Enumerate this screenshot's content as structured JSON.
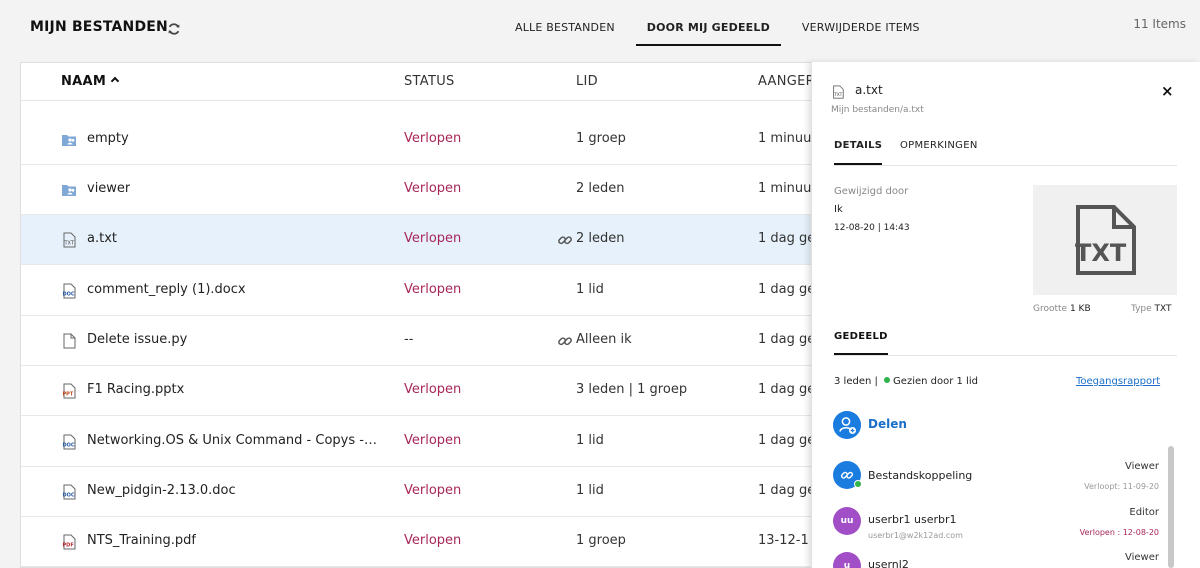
{
  "header": {
    "title": "MIJN BESTANDEN",
    "tabs": [
      "ALLE BESTANDEN",
      "DOOR MIJ GEDEELD",
      "VERWIJDERDE ITEMS"
    ],
    "active_tab": "DOOR MIJ GEDEELD",
    "items_count": "11 Items"
  },
  "table": {
    "columns": [
      "NAAM",
      "STATUS",
      "LID",
      "AANGER"
    ],
    "rows": [
      {
        "name": "empty",
        "icon": "shared-folder-icon",
        "status": "Verlopen",
        "lid": "1 groep",
        "date": "1 minuut",
        "link": false
      },
      {
        "name": "viewer",
        "icon": "shared-folder-icon",
        "status": "Verlopen",
        "lid": "2 leden",
        "date": "1 minuut",
        "link": false
      },
      {
        "name": "a.txt",
        "icon": "txt-file-icon",
        "status": "Verlopen",
        "lid": "2 leden",
        "date": "1 dag ge",
        "link": true
      },
      {
        "name": "comment_reply (1).docx",
        "icon": "doc-file-icon",
        "status": "Verlopen",
        "lid": "1 lid",
        "date": "1 dag ge",
        "link": false
      },
      {
        "name": "Delete issue.py",
        "icon": "file-icon",
        "status": "--",
        "lid": "Alleen ik",
        "date": "1 dag ge",
        "link": true
      },
      {
        "name": "F1 Racing.pptx",
        "icon": "ppt-file-icon",
        "status": "Verlopen",
        "lid": "3 leden | 1 groep",
        "date": "1 dag ge",
        "link": false
      },
      {
        "name": "Networking.OS & Unix Command - Copys - ...",
        "icon": "doc-file-icon",
        "status": "Verlopen",
        "lid": "1 lid",
        "date": "1 dag ge",
        "link": false
      },
      {
        "name": "New_pidgin-2.13.0.doc",
        "icon": "doc-file-icon",
        "status": "Verlopen",
        "lid": "1 lid",
        "date": "1 dag ge",
        "link": false
      },
      {
        "name": "NTS_Training.pdf",
        "icon": "pdf-file-icon",
        "status": "Verlopen",
        "lid": "1 groep",
        "date": "13-12-1",
        "link": false
      }
    ]
  },
  "panel": {
    "file_name": "a.txt",
    "file_path": "Mijn bestanden/a.txt",
    "close": "×",
    "tabs": [
      "DETAILS",
      "OPMERKINGEN"
    ],
    "modified_label": "Gewijzigd door",
    "modified_by": "Ik",
    "modified_date": "12-08-20 | 14:43",
    "preview_text": "TXT",
    "size_label": "Grootte",
    "size_value": "1 KB",
    "type_label": "Type",
    "type_value": "TXT",
    "shared_title": "GEDEELD",
    "members_count": "3 leden",
    "seen_by": "Gezien door 1 lid",
    "access_report": "Toegangsrapport",
    "share_label": "Delen",
    "members": [
      {
        "avatar": "",
        "name": "Bestandskoppeling",
        "sub": "",
        "role": "Viewer",
        "expiry": "Verloopt: 11-09-20"
      },
      {
        "avatar": "uu",
        "name": "userbr1 userbr1",
        "sub": "userbr1@w2k12ad.com",
        "role": "Editor",
        "expiry": "Verlopen : 12-08-20"
      },
      {
        "avatar": "u",
        "name": "usernl2",
        "sub": "",
        "role": "Viewer",
        "expiry": ""
      }
    ]
  }
}
